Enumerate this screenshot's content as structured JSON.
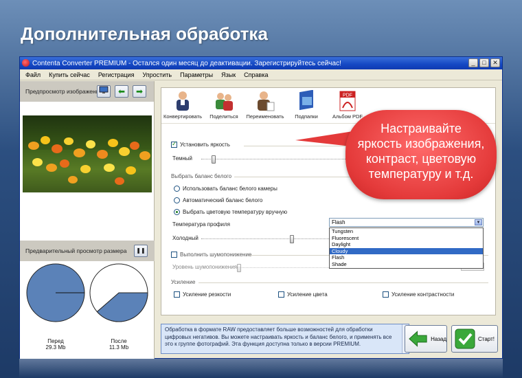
{
  "headline": "Дополнительная обработка",
  "window": {
    "title": "Contenta Converter PREMIUM - Остался один месяц до деактивации. Зарегистрируйтесь сейчас!",
    "btn_min": "_",
    "btn_max": "□",
    "btn_close": "✕"
  },
  "menu": [
    "Файл",
    "Купить сейчас",
    "Регистрация",
    "Упростить",
    "Параметры",
    "Язык",
    "Справка"
  ],
  "left": {
    "preview_label": "Предпросмотр изображения",
    "size_preview_label": "Предварительный просмотр размера",
    "pause_glyph": "❚❚",
    "before_label": "Перед",
    "before_size": "29.3 Mb",
    "after_label": "После",
    "after_size": "11.3 Mb"
  },
  "sizes": {
    "before_fraction": 1.0,
    "after_fraction": 0.386
  },
  "toolbar": [
    {
      "label": "Конвертировать",
      "icon": "convert-icon"
    },
    {
      "label": "Поделиться",
      "icon": "share-icon"
    },
    {
      "label": "Переименовать",
      "icon": "rename-icon"
    },
    {
      "label": "Подпапки",
      "icon": "subfolders-icon"
    },
    {
      "label": "Альбом PDF",
      "icon": "pdf-album-icon"
    }
  ],
  "pdf_icon_text": "PDF",
  "brightness": {
    "checkbox_label": "Установить яркость",
    "checked": true,
    "dark_label": "Темный",
    "level": 0.04
  },
  "whitebalance": {
    "group_label": "Выбрать баланс белого",
    "options": [
      "Использовать баланс белого камеры",
      "Автоматический баланс белого",
      "Выбрать цветовую температуру вручную"
    ],
    "selected_index": 2,
    "profile_label": "Температура профиля",
    "profile_value": "Flash",
    "cold_label": "Холодный",
    "level": 0.34,
    "list": [
      "Tungsten",
      "Fluorescent",
      "Daylight",
      "Cloudy",
      "Flash",
      "Shade"
    ],
    "highlighted": "Cloudy"
  },
  "noise": {
    "checkbox_label": "Выполнить шумопонижение",
    "level_label": "Уровень шумопонижения"
  },
  "enhance": {
    "group_label": "Усиление",
    "sharpness": "Усиление резкости",
    "color": "Усиление цвета",
    "contrast": "Усиление контрастности"
  },
  "info": "Обработка в формате RAW предоставляет больше возможностей для обработки цифровых негативов. Вы можете настраивать яркость и баланс белого, и применять все это к группе фотографий. Эта функция доступна только в версии PREMIUM.",
  "buttons": {
    "back": "Назад",
    "start": "Старт!"
  },
  "callout": [
    "Настраивайте",
    "яркость изображения,",
    "контраст, цветовую",
    "температуру и т.д."
  ],
  "colors": {
    "accent": "#316ac5",
    "callout": "#e43a3a",
    "pie": "#5b82b8"
  }
}
